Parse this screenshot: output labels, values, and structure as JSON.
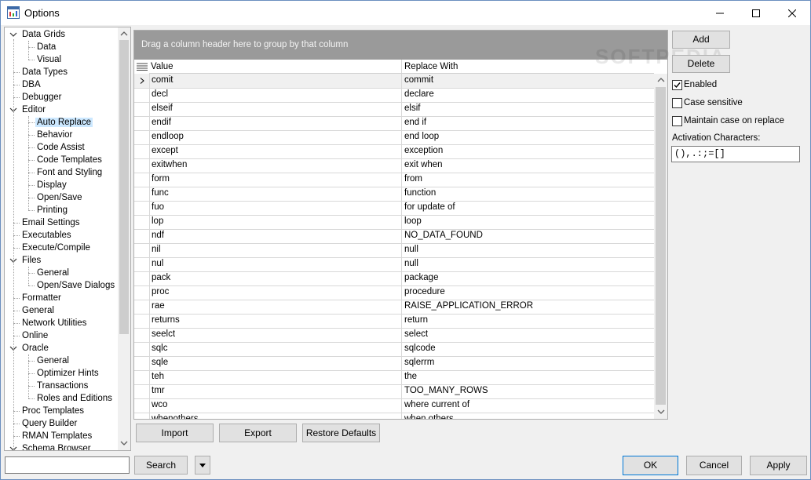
{
  "window": {
    "title": "Options"
  },
  "tree": {
    "items": [
      {
        "label": "Data Grids",
        "level": 0,
        "expanded": true
      },
      {
        "label": "Data",
        "level": 1
      },
      {
        "label": "Visual",
        "level": 1
      },
      {
        "label": "Data Types",
        "level": 0
      },
      {
        "label": "DBA",
        "level": 0
      },
      {
        "label": "Debugger",
        "level": 0
      },
      {
        "label": "Editor",
        "level": 0,
        "expanded": true
      },
      {
        "label": "Auto Replace",
        "level": 1,
        "selected": true
      },
      {
        "label": "Behavior",
        "level": 1
      },
      {
        "label": "Code Assist",
        "level": 1
      },
      {
        "label": "Code Templates",
        "level": 1
      },
      {
        "label": "Font and Styling",
        "level": 1
      },
      {
        "label": "Display",
        "level": 1
      },
      {
        "label": "Open/Save",
        "level": 1
      },
      {
        "label": "Printing",
        "level": 1
      },
      {
        "label": "Email Settings",
        "level": 0
      },
      {
        "label": "Executables",
        "level": 0
      },
      {
        "label": "Execute/Compile",
        "level": 0
      },
      {
        "label": "Files",
        "level": 0,
        "expanded": true
      },
      {
        "label": "General",
        "level": 1
      },
      {
        "label": "Open/Save Dialogs",
        "level": 1
      },
      {
        "label": "Formatter",
        "level": 0
      },
      {
        "label": "General",
        "level": 0
      },
      {
        "label": "Network Utilities",
        "level": 0
      },
      {
        "label": "Online",
        "level": 0
      },
      {
        "label": "Oracle",
        "level": 0,
        "expanded": true
      },
      {
        "label": "General",
        "level": 1
      },
      {
        "label": "Optimizer Hints",
        "level": 1
      },
      {
        "label": "Transactions",
        "level": 1
      },
      {
        "label": "Roles and Editions",
        "level": 1
      },
      {
        "label": "Proc Templates",
        "level": 0
      },
      {
        "label": "Query Builder",
        "level": 0
      },
      {
        "label": "RMAN Templates",
        "level": 0
      },
      {
        "label": "Schema Browser",
        "level": 0,
        "expanded": true
      }
    ]
  },
  "grid": {
    "group_hint": "Drag a column header here to group by that column",
    "columns": [
      "Value",
      "Replace With"
    ],
    "rows": [
      [
        "comit",
        "commit"
      ],
      [
        "decl",
        "declare"
      ],
      [
        "elseif",
        "elsif"
      ],
      [
        "endif",
        "end if"
      ],
      [
        "endloop",
        "end loop"
      ],
      [
        "except",
        "exception"
      ],
      [
        "exitwhen",
        "exit when"
      ],
      [
        "form",
        "from"
      ],
      [
        "func",
        "function"
      ],
      [
        "fuo",
        "for update of"
      ],
      [
        "lop",
        "loop"
      ],
      [
        "ndf",
        "NO_DATA_FOUND"
      ],
      [
        "nil",
        "null"
      ],
      [
        "nul",
        "null"
      ],
      [
        "pack",
        "package"
      ],
      [
        "proc",
        "procedure"
      ],
      [
        "rae",
        "RAISE_APPLICATION_ERROR"
      ],
      [
        "returns",
        "return"
      ],
      [
        "seelct",
        "select"
      ],
      [
        "sqlc",
        "sqlcode"
      ],
      [
        "sqle",
        "sqlerrm"
      ],
      [
        "teh",
        "the"
      ],
      [
        "tmr",
        "TOO_MANY_ROWS"
      ],
      [
        "wco",
        "where current of"
      ],
      [
        "whenothers",
        "when others"
      ]
    ]
  },
  "grid_buttons": {
    "import": "Import",
    "export": "Export",
    "restore": "Restore Defaults"
  },
  "side": {
    "add": "Add",
    "delete": "Delete",
    "enabled": {
      "label": "Enabled",
      "checked": true
    },
    "case_sensitive": {
      "label": "Case sensitive",
      "checked": false
    },
    "maintain_case": {
      "label": "Maintain case on replace",
      "checked": false
    },
    "activation_label": "Activation Characters:",
    "activation_value": "(),.:;=[]"
  },
  "watermark": "SOFTPEDIA",
  "bottom": {
    "search_value": "",
    "search": "Search",
    "ok": "OK",
    "cancel": "Cancel",
    "apply": "Apply"
  }
}
